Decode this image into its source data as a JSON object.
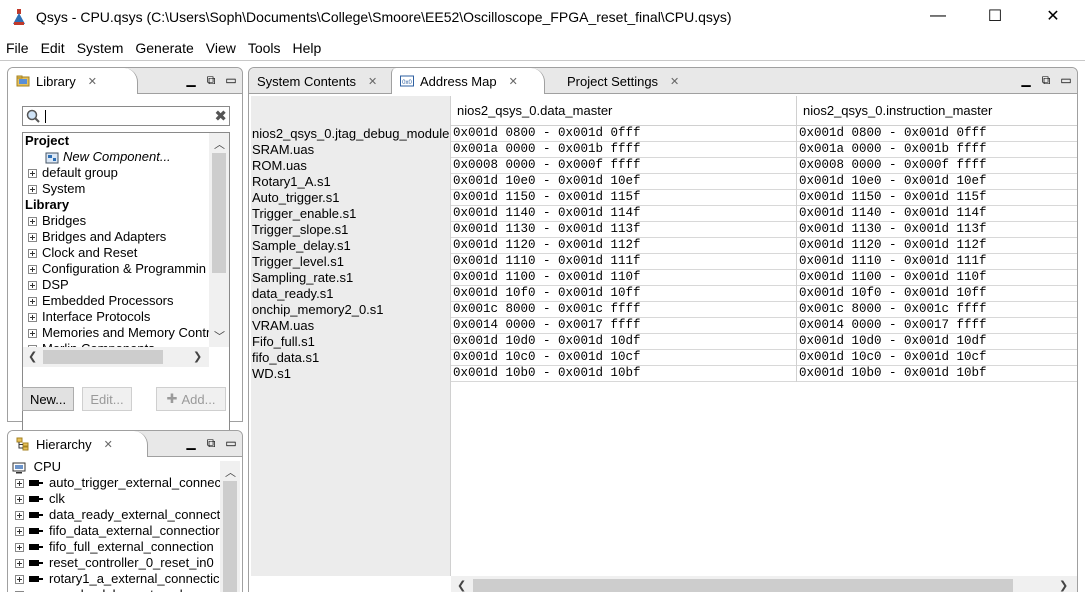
{
  "window": {
    "title": "Qsys - CPU.qsys (C:\\Users\\Soph\\Documents\\College\\Smoore\\EE52\\Oscilloscope_FPGA_reset_final\\CPU.qsys)",
    "minimize": "—",
    "maximize": "☐",
    "close": "✕"
  },
  "menu": [
    "File",
    "Edit",
    "System",
    "Generate",
    "View",
    "Tools",
    "Help"
  ],
  "library": {
    "tab_label": "Library",
    "search_placeholder": "",
    "tree": [
      {
        "type": "header",
        "label": "Project"
      },
      {
        "type": "item",
        "label": "New Component...",
        "italic": true,
        "indent": 2
      },
      {
        "type": "group",
        "label": "default group"
      },
      {
        "type": "group",
        "label": "System"
      },
      {
        "type": "header",
        "label": "Library"
      },
      {
        "type": "group",
        "label": "Bridges"
      },
      {
        "type": "group",
        "label": "Bridges and Adapters"
      },
      {
        "type": "group",
        "label": "Clock and Reset"
      },
      {
        "type": "group",
        "label": "Configuration & Programmin"
      },
      {
        "type": "group",
        "label": "DSP"
      },
      {
        "type": "group",
        "label": "Embedded Processors"
      },
      {
        "type": "group",
        "label": "Interface Protocols"
      },
      {
        "type": "group",
        "label": "Memories and Memory Contr"
      },
      {
        "type": "group",
        "label": "Merlin Components"
      }
    ],
    "buttons": {
      "new": "New...",
      "edit": "Edit...",
      "add": "Add..."
    }
  },
  "hierarchy": {
    "tab_label": "Hierarchy",
    "root": "CPU",
    "items": [
      "auto_trigger_external_connec",
      "clk",
      "data_ready_external_connect",
      "fifo_data_external_connectior",
      "fifo_full_external_connection",
      "reset_controller_0_reset_in0",
      "rotary1_a_external_connectic",
      "sample_delay_external_con"
    ]
  },
  "main": {
    "tabs": [
      {
        "label": "System Contents",
        "active": false
      },
      {
        "label": "Address Map",
        "active": true
      },
      {
        "label": "Project Settings",
        "active": false
      }
    ],
    "columns": [
      "nios2_qsys_0.data_master",
      "nios2_qsys_0.instruction_master"
    ],
    "rows": [
      {
        "slave": "nios2_qsys_0.jtag_debug_module",
        "data": "0x001d 0800 - 0x001d 0fff",
        "instr": "0x001d 0800 - 0x001d 0fff"
      },
      {
        "slave": "SRAM.uas",
        "data": "0x001a 0000 - 0x001b ffff",
        "instr": "0x001a 0000 - 0x001b ffff"
      },
      {
        "slave": "ROM.uas",
        "data": "0x0008 0000 - 0x000f ffff",
        "instr": "0x0008 0000 - 0x000f ffff"
      },
      {
        "slave": "Rotary1_A.s1",
        "data": "0x001d 10e0 - 0x001d 10ef",
        "instr": "0x001d 10e0 - 0x001d 10ef"
      },
      {
        "slave": "Auto_trigger.s1",
        "data": "0x001d 1150 - 0x001d 115f",
        "instr": "0x001d 1150 - 0x001d 115f"
      },
      {
        "slave": "Trigger_enable.s1",
        "data": "0x001d 1140 - 0x001d 114f",
        "instr": "0x001d 1140 - 0x001d 114f"
      },
      {
        "slave": "Trigger_slope.s1",
        "data": "0x001d 1130 - 0x001d 113f",
        "instr": "0x001d 1130 - 0x001d 113f"
      },
      {
        "slave": "Sample_delay.s1",
        "data": "0x001d 1120 - 0x001d 112f",
        "instr": "0x001d 1120 - 0x001d 112f"
      },
      {
        "slave": "Trigger_level.s1",
        "data": "0x001d 1110 - 0x001d 111f",
        "instr": "0x001d 1110 - 0x001d 111f"
      },
      {
        "slave": "Sampling_rate.s1",
        "data": "0x001d 1100 - 0x001d 110f",
        "instr": "0x001d 1100 - 0x001d 110f"
      },
      {
        "slave": "data_ready.s1",
        "data": "0x001d 10f0 - 0x001d 10ff",
        "instr": "0x001d 10f0 - 0x001d 10ff"
      },
      {
        "slave": "onchip_memory2_0.s1",
        "data": "0x001c 8000 - 0x001c ffff",
        "instr": "0x001c 8000 - 0x001c ffff"
      },
      {
        "slave": "VRAM.uas",
        "data": "0x0014 0000 - 0x0017 ffff",
        "instr": "0x0014 0000 - 0x0017 ffff"
      },
      {
        "slave": "Fifo_full.s1",
        "data": "0x001d 10d0 - 0x001d 10df",
        "instr": "0x001d 10d0 - 0x001d 10df"
      },
      {
        "slave": "fifo_data.s1",
        "data": "0x001d 10c0 - 0x001d 10cf",
        "instr": "0x001d 10c0 - 0x001d 10cf"
      },
      {
        "slave": "WD.s1",
        "data": "0x001d 10b0 - 0x001d 10bf",
        "instr": "0x001d 10b0 - 0x001d 10bf"
      }
    ]
  },
  "colors": {
    "accent": "#0078d7",
    "panel_bg": "#e8e8e8",
    "row_name_bg": "#ececec"
  }
}
